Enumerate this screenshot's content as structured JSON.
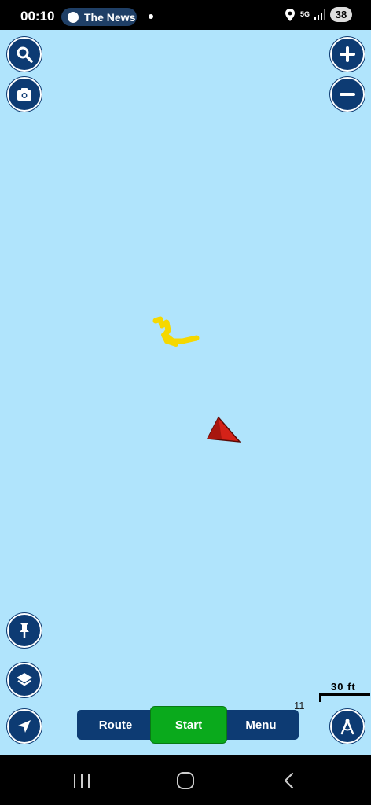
{
  "status": {
    "time": "00:10",
    "notification_text": "The News",
    "network": "5G",
    "battery": "38"
  },
  "map": {
    "background_color": "#b0e4fc",
    "track_color": "#f5d800",
    "position_marker_color": "#d42218",
    "zoom_level": "11",
    "scale_label": "30 ft"
  },
  "buttons": {
    "search": "search-icon",
    "camera": "camera-icon",
    "zoom_in": "plus-icon",
    "zoom_out": "minus-icon",
    "pin": "pin-icon",
    "layers": "layers-icon",
    "locate": "navigation-arrow-icon",
    "compass": "compass-icon"
  },
  "bottom_bar": {
    "route_label": "Route",
    "start_label": "Start",
    "menu_label": "Menu"
  },
  "accent_color": "#0d3b73",
  "start_color": "#0aaa1c"
}
